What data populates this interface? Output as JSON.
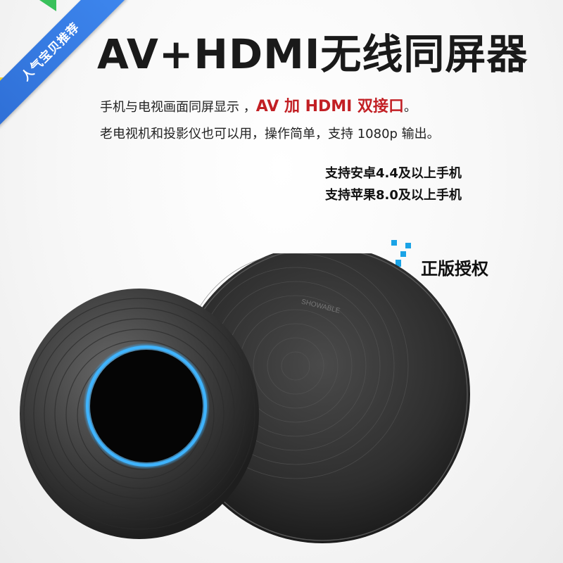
{
  "ribbon": {
    "label": "人气宝贝推荐"
  },
  "headline": "AV+HDMI无线同屏器",
  "description": {
    "line1_prefix": "手机与电视画面同屏显示 ，",
    "line1_highlight": "AV 加 HDMI 双接口",
    "line1_suffix": "。",
    "line2": "老电视机和投影仪也可以用，操作简单，支持 1080p 输出。"
  },
  "support": {
    "android": "支持安卓4.4及以上手机",
    "apple": "支持苹果8.0及以上手机"
  },
  "badge": {
    "label": "正版授权",
    "icon": "authorized-icon",
    "color": "#1aa3e6"
  },
  "product": {
    "back_embossed_text": "SHOWABLE"
  },
  "colors": {
    "highlight": "#c21f24",
    "ribbon": "#2f6fd6",
    "ring": "#3fb4ff"
  }
}
